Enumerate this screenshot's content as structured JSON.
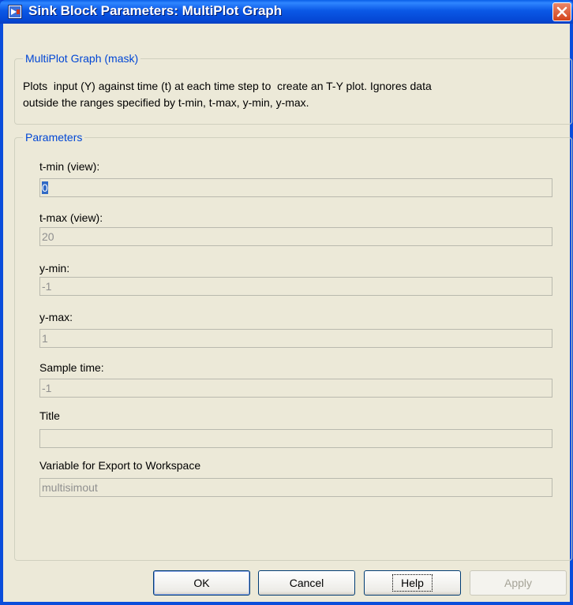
{
  "window": {
    "title": "Sink Block Parameters: MultiPlot Graph",
    "icon": "simulink-block-icon",
    "close_icon": "close-icon"
  },
  "mask_group": {
    "label": "MultiPlot Graph (mask)",
    "description_line1": "Plots  input (Y) against time (t) at each time step to  create an T-Y plot. Ignores data",
    "description_line2": "outside the ranges specified by t-min, t-max, y-min, y-max."
  },
  "parameters": {
    "label": "Parameters",
    "tmin": {
      "label": "t-min (view):",
      "value": "0"
    },
    "tmax": {
      "label": "t-max (view):",
      "value": "20"
    },
    "ymin": {
      "label": "y-min:",
      "value": "-1"
    },
    "ymax": {
      "label": "y-max:",
      "value": "1"
    },
    "sample_time": {
      "label": "Sample time:",
      "value": "-1"
    },
    "title": {
      "label": "Title",
      "value": ""
    },
    "export_var": {
      "label": "Variable for Export to Workspace",
      "value": "multisimout"
    }
  },
  "buttons": {
    "ok": "OK",
    "cancel": "Cancel",
    "help": "Help",
    "apply": "Apply"
  },
  "colors": {
    "titlebar": "#0a58e6",
    "group_label": "#0046d5",
    "dialog_bg": "#ece9d8",
    "close": "#d4431b"
  }
}
